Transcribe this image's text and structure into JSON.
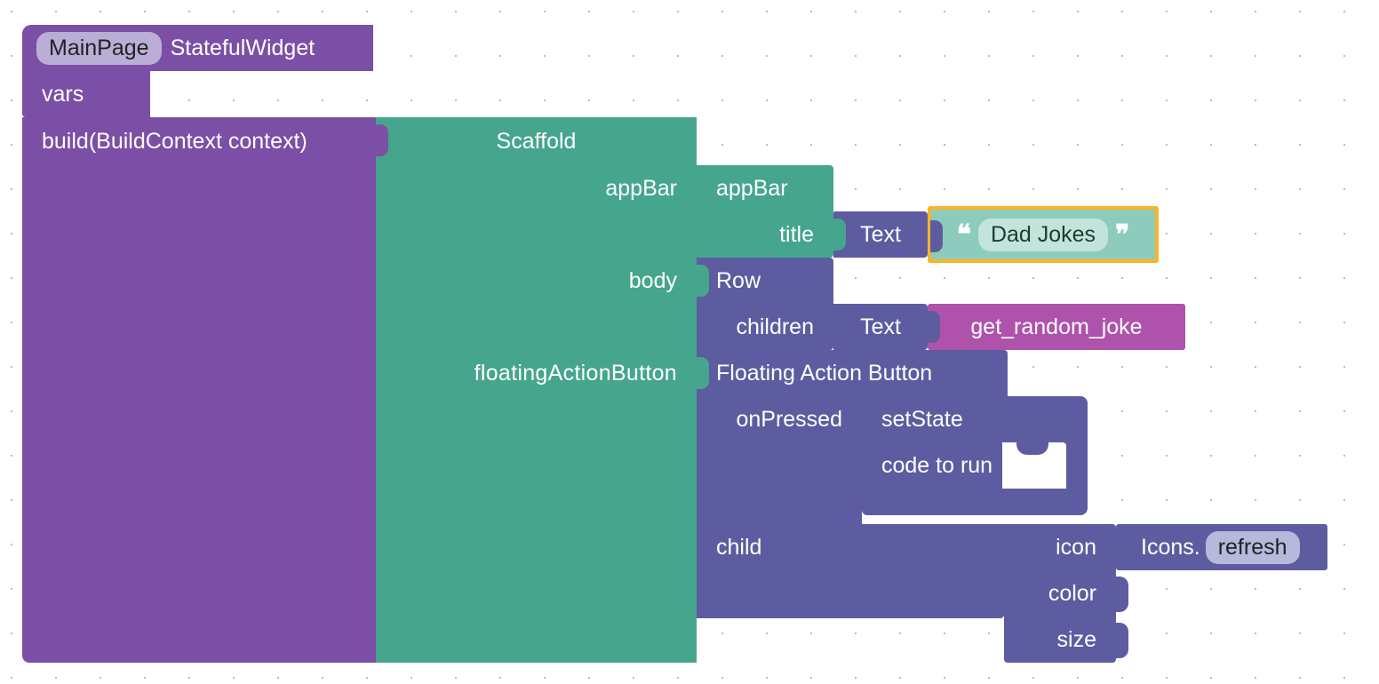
{
  "header": {
    "className": "MainPage",
    "widgetType": "StatefulWidget",
    "vars": "vars",
    "build": "build(BuildContext context)"
  },
  "scaffold": {
    "label": "Scaffold",
    "appBar": "appBar",
    "body": "body",
    "fab": "floatingActionButton"
  },
  "appBar": {
    "label": "appBar",
    "title": "title"
  },
  "textBlock": {
    "label": "Text"
  },
  "stringBlock": {
    "value": "Dad Jokes"
  },
  "row": {
    "label": "Row",
    "children": "children"
  },
  "text2": {
    "label": "Text"
  },
  "func": {
    "name": "get_random_joke"
  },
  "fab": {
    "label": "Floating Action Button",
    "onPressed": "onPressed",
    "child": "child"
  },
  "setState": {
    "label": "setState",
    "code": "code to run"
  },
  "icon": {
    "label": "icon",
    "color": "color",
    "size": "size"
  },
  "icons": {
    "prefix": "Icons.",
    "value": "refresh"
  },
  "colors": {
    "purple": "#7b4fa5",
    "teal": "#46a58d",
    "lav": "#5e5ca0",
    "magenta": "#af52ab",
    "mint": "#8dccbc",
    "pillPurple": "#bbaed6",
    "pillLav": "#b6b9dc",
    "yellow": "#f9b42d"
  }
}
